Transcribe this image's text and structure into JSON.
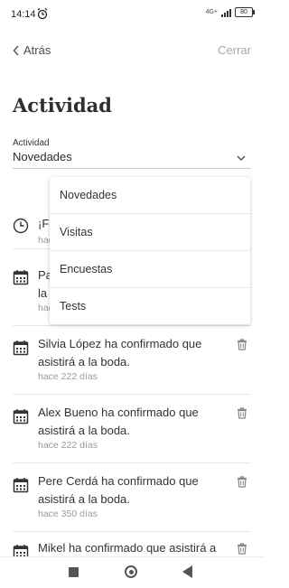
{
  "status_bar": {
    "time": "14:14",
    "network": "4G+",
    "battery": "80"
  },
  "nav": {
    "back_label": "Atrás",
    "close_label": "Cerrar"
  },
  "page": {
    "title": "Actividad"
  },
  "filter": {
    "label": "Actividad",
    "selected": "Novedades",
    "options": [
      "Novedades",
      "Visitas",
      "Encuestas",
      "Tests"
    ]
  },
  "feed": [
    {
      "icon": "clock-icon",
      "text": "¡Fa",
      "time": "hace"
    },
    {
      "icon": "calendar-icon",
      "text": "Pa\nla",
      "time": "hac"
    },
    {
      "icon": "calendar-icon",
      "text": "Silvia López ha confirmado que asistirá a la boda.",
      "time": "hace 222 días"
    },
    {
      "icon": "calendar-icon",
      "text": "Alex Bueno ha confirmado que asistirá a la boda.",
      "time": "hace 222 días"
    },
    {
      "icon": "calendar-icon",
      "text": "Pere Cerdá ha confirmado que asistirá a la boda.",
      "time": "hace 350 días"
    },
    {
      "icon": "calendar-icon",
      "text": "Mikel ha confirmado que asistirá a la",
      "time": ""
    }
  ]
}
